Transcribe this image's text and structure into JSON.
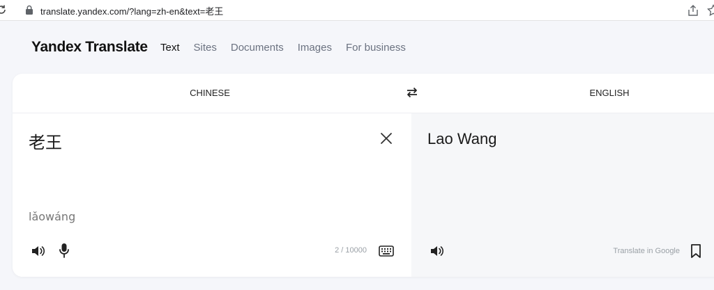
{
  "browser": {
    "url": "translate.yandex.com/?lang=zh-en&text=老王",
    "icons": [
      "reload-icon",
      "lock-icon",
      "share-icon",
      "star-icon"
    ]
  },
  "header": {
    "logo": "Yandex Translate",
    "nav": [
      {
        "label": "Text",
        "active": true
      },
      {
        "label": "Sites",
        "active": false
      },
      {
        "label": "Documents",
        "active": false
      },
      {
        "label": "Images",
        "active": false
      },
      {
        "label": "For business",
        "active": false
      }
    ]
  },
  "translator": {
    "source_lang": "CHINESE",
    "target_lang": "ENGLISH",
    "source_text": "老王",
    "transliteration": "lǎowáng",
    "char_count": "2 / 10000",
    "target_text": "Lao Wang",
    "translate_in_google": "Translate in Google"
  },
  "colors": {
    "page_bg": "#f5f6fa",
    "card_bg": "#ffffff",
    "target_pane_bg": "#f6f7f9",
    "text": "#1a1a1a",
    "muted": "#6b7280",
    "hint": "#9aa0a6"
  }
}
